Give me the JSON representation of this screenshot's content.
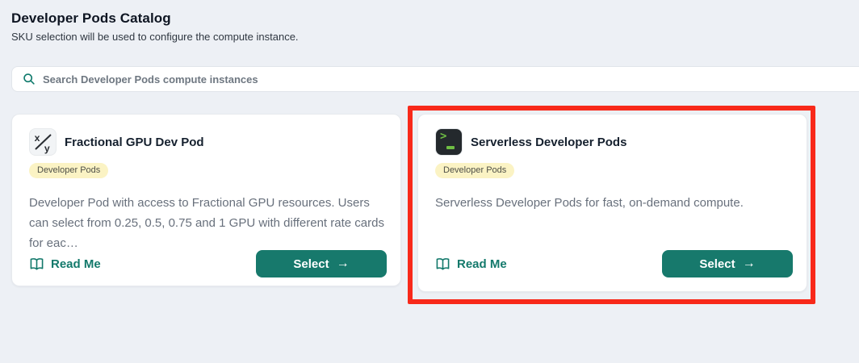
{
  "page": {
    "title": "Developer Pods Catalog",
    "subtitle": "SKU selection will be used to configure the compute instance."
  },
  "search": {
    "placeholder": "Search Developer Pods compute instances",
    "value": "",
    "icon": "search-icon"
  },
  "cards": [
    {
      "title": "Fractional GPU Dev Pod",
      "icon": "fraction-xy-icon",
      "badge": "Developer Pods",
      "description": "Developer Pod with access to Fractional GPU resources. Users can select from 0.25, 0.5, 0.75 and 1 GPU with different rate cards for eac…",
      "readme_label": "Read Me",
      "select_label": "Select"
    },
    {
      "title": "Serverless Developer Pods",
      "icon": "terminal-icon",
      "badge": "Developer Pods",
      "description": "Serverless Developer Pods for fast, on-demand compute.",
      "readme_label": "Read Me",
      "select_label": "Select"
    }
  ],
  "icons": {
    "arrow_right": "→",
    "terminal_prompt": ">"
  },
  "annotation": {
    "type": "highlight-rectangle",
    "color": "#F8291A",
    "target": "Serverless Developer Pods card"
  },
  "colors": {
    "background": "#EDF0F5",
    "teal_accent": "#17796C",
    "badge_background": "#FBF3C4",
    "card_background": "#FFFFFF"
  }
}
